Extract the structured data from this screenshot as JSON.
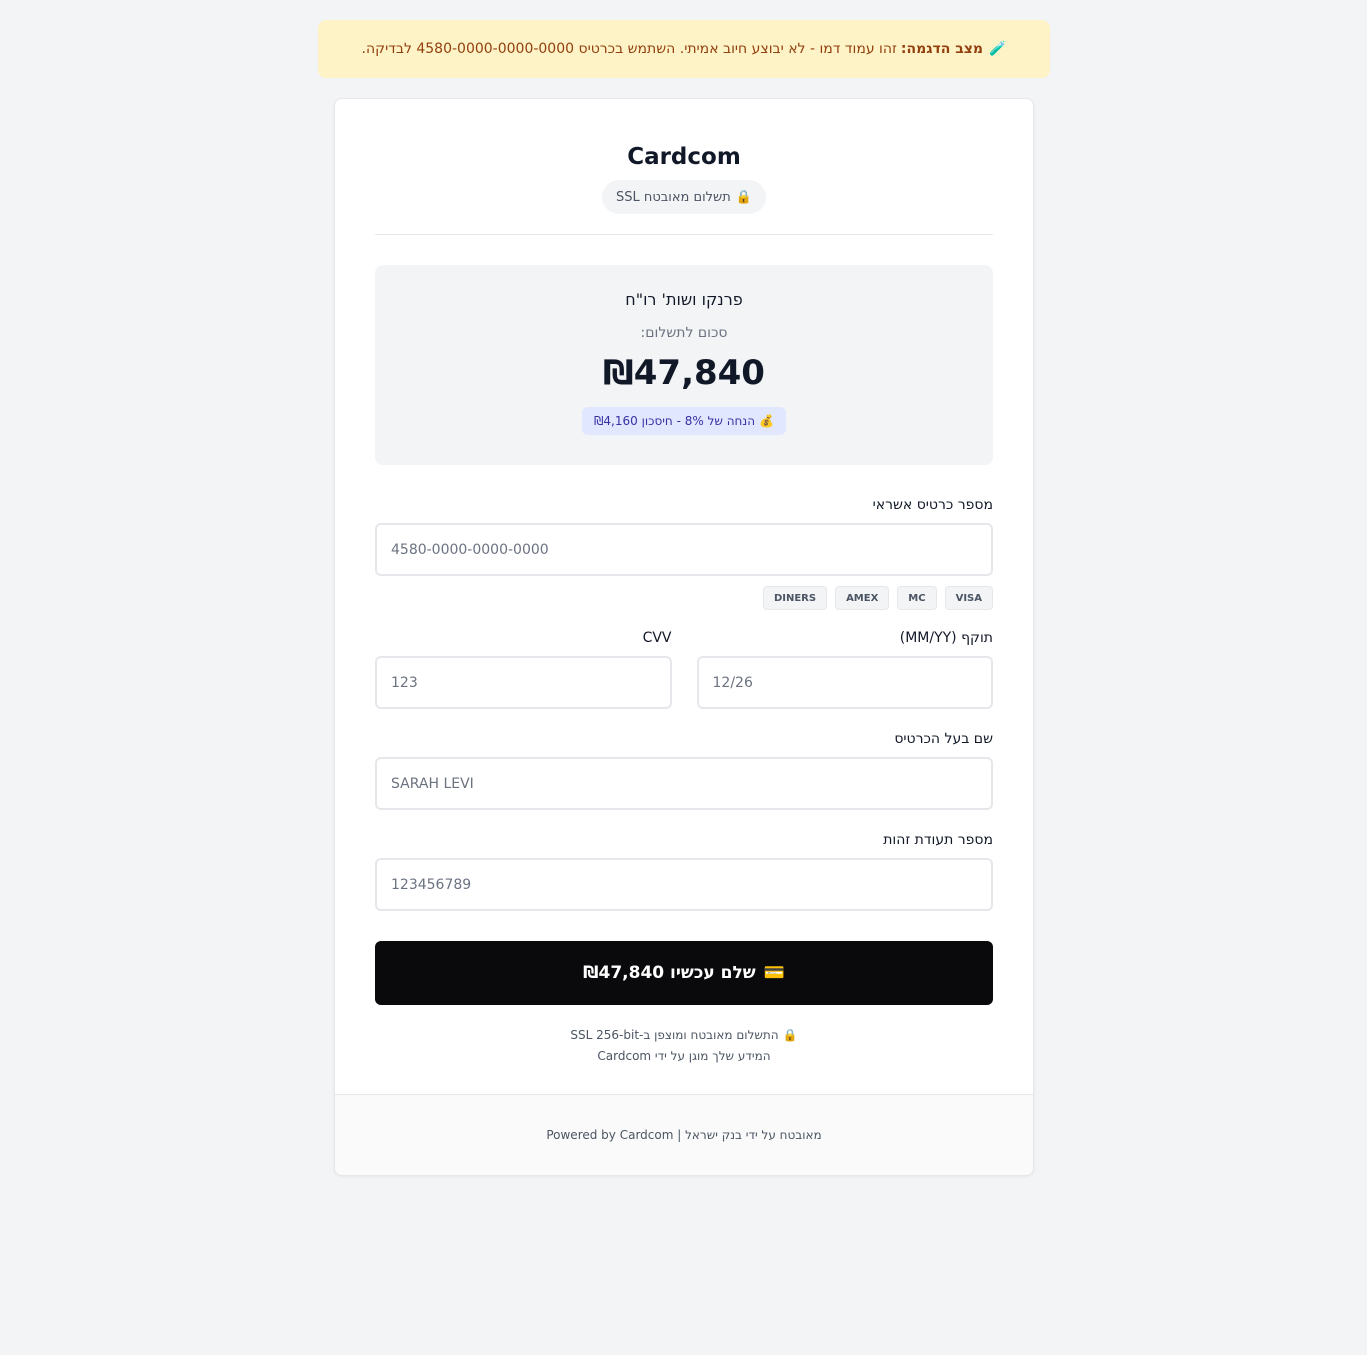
{
  "banner": {
    "icon": "test-tube-icon",
    "icon_glyph": "🧪",
    "bold": "מצב הדגמה:",
    "text": "זהו עמוד דמו - לא יבוצע חיוב אמיתי. השתמש בכרטיס 4580-0000-0000-0000 לבדיקה."
  },
  "header": {
    "brand": "Cardcom",
    "secure_icon": "lock-icon",
    "secure_icon_glyph": "🔒",
    "secure_label": "תשלום מאובטח SSL"
  },
  "summary": {
    "merchant": "פרנקו ושות' רו\"ח",
    "amount_label": "סכום לתשלום:",
    "amount": "₪47,840",
    "discount_icon": "money-bag-icon",
    "discount_icon_glyph": "💰",
    "discount_text": "הנחה של 8% - חיסכון ₪4,160"
  },
  "form": {
    "card_number": {
      "label": "מספר כרטיס אשראי",
      "placeholder": "4580-0000-0000-0000",
      "value": ""
    },
    "card_brands": [
      "VISA",
      "MC",
      "AMEX",
      "DINERS"
    ],
    "expiry": {
      "label": "תוקף (MM/YY)",
      "placeholder": "12/26",
      "value": ""
    },
    "cvv": {
      "label": "CVV",
      "placeholder": "123",
      "value": ""
    },
    "holder": {
      "label": "שם בעל הכרטיס",
      "placeholder": "SARAH LEVI",
      "value": ""
    },
    "id_number": {
      "label": "מספר תעודת זהות",
      "placeholder": "123456789",
      "value": ""
    },
    "pay_button": {
      "icon": "credit-card-icon",
      "icon_glyph": "💳",
      "label": "שלם עכשיו ₪47,840"
    }
  },
  "security_note": {
    "icon": "lock-icon",
    "icon_glyph": "🔒",
    "line1": "התשלום מאובטח ומוצפן ב-SSL 256-bit",
    "line2": "המידע שלך מוגן על ידי Cardcom"
  },
  "footer": {
    "text": "Powered by Cardcom | מאובטח על ידי בנק ישראל"
  },
  "colors": {
    "banner_bg": "#fef3c7",
    "banner_text": "#92400e",
    "discount_bg": "#e0e7ff",
    "discount_text": "#3730a3",
    "pay_button_bg": "#0a0a0c",
    "page_bg": "#f3f4f6"
  }
}
